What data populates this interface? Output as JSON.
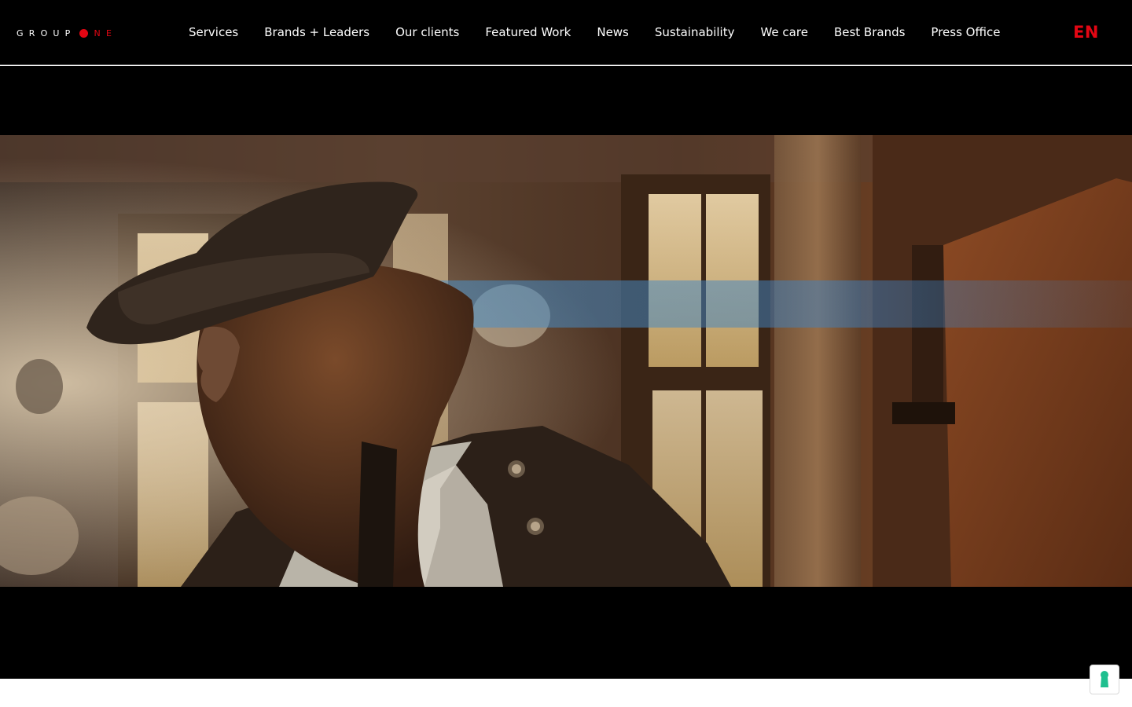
{
  "brand": {
    "logo_word_1": "GROUP",
    "logo_word_2": "NE",
    "accent": "#e30613"
  },
  "nav": {
    "items": [
      {
        "label": "Services"
      },
      {
        "label": "Brands + Leaders"
      },
      {
        "label": "Our clients"
      },
      {
        "label": "Featured Work"
      },
      {
        "label": "News"
      },
      {
        "label": "Sustainability"
      },
      {
        "label": "We care"
      },
      {
        "label": "Best Brands"
      },
      {
        "label": "Press Office"
      }
    ]
  },
  "language": {
    "current": "EN"
  },
  "hero": {
    "media": "video-still-pirate-in-tavern"
  },
  "privacy": {
    "icon": "keyhole-icon",
    "color": "#1fbf8f"
  },
  "colors": {
    "header_bg": "#000000",
    "header_text": "#ffffff",
    "page_bg": "#ffffff"
  }
}
